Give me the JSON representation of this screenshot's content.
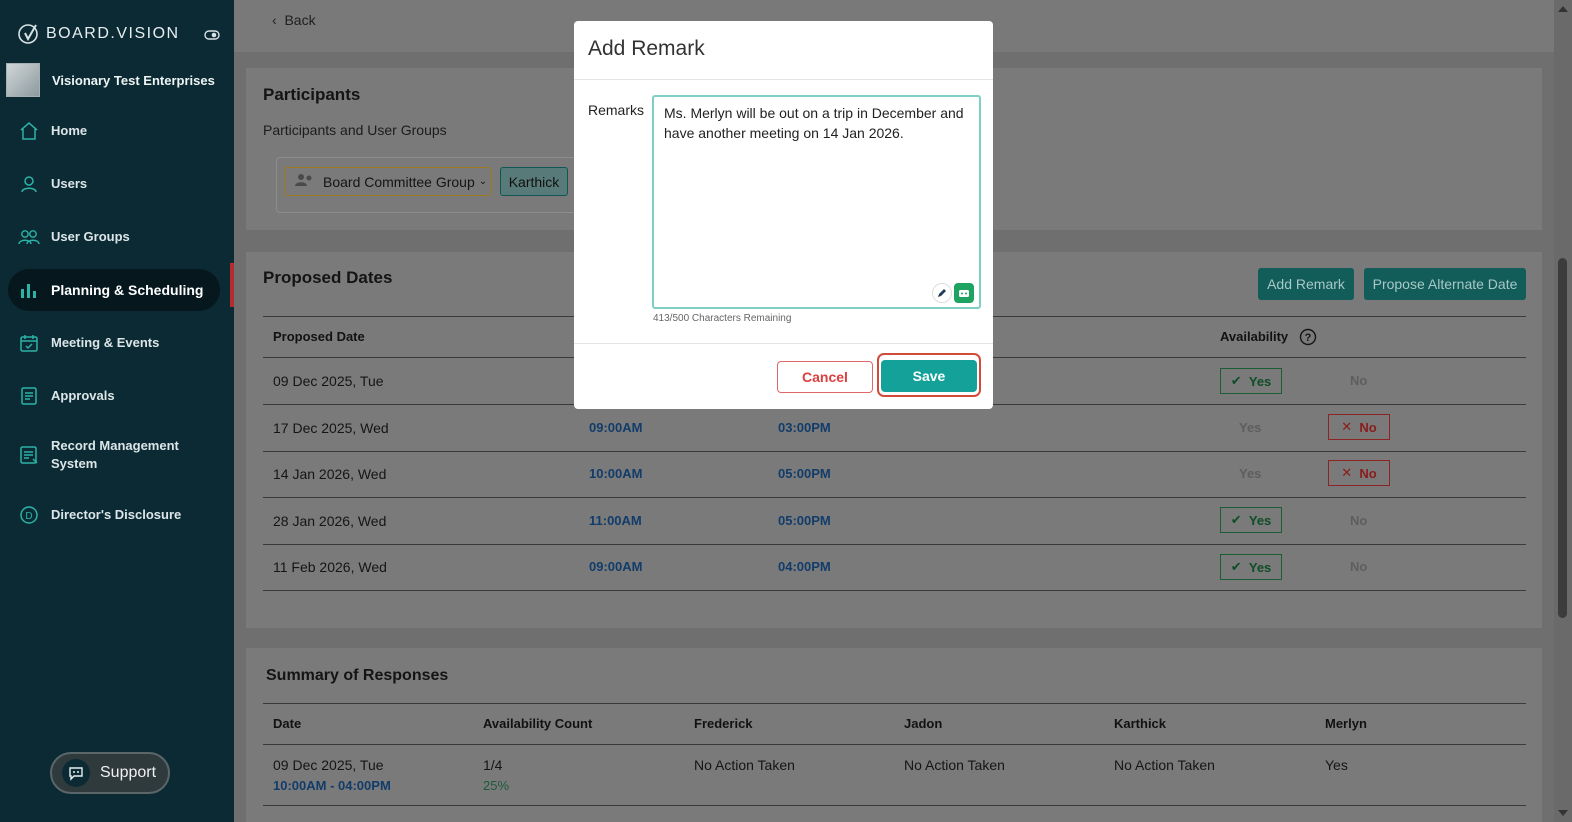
{
  "sidebar": {
    "logo": "BOARD.VISION",
    "org_name": "Visionary Test Enterprises",
    "items": [
      {
        "label": "Home",
        "icon": "home-icon"
      },
      {
        "label": "Users",
        "icon": "user-icon"
      },
      {
        "label": "User Groups",
        "icon": "users-icon"
      },
      {
        "label": "Planning & Scheduling",
        "icon": "bar-chart-icon",
        "active": true
      },
      {
        "label": "Meeting & Events",
        "icon": "calendar-icon"
      },
      {
        "label": "Approvals",
        "icon": "document-icon"
      },
      {
        "label": "Record Management System",
        "label_line1": "Record Management",
        "label_line2": "System",
        "icon": "records-icon"
      },
      {
        "label": "Director's Disclosure",
        "icon": "disclosure-icon"
      }
    ],
    "support_label": "Support"
  },
  "header": {
    "back_label": "Back"
  },
  "participants": {
    "title": "Participants",
    "subtitle": "Participants and User Groups",
    "group_chip": "Board Committee Group",
    "person_chip": "Karthick"
  },
  "proposed_dates": {
    "title": "Proposed Dates",
    "add_remark_label": "Add Remark",
    "propose_alternate_label": "Propose Alternate Date",
    "columns": {
      "date": "Proposed Date",
      "availability": "Availability"
    },
    "rows": [
      {
        "date": "09 Dec 2025, Tue",
        "start": "",
        "end": "",
        "selected": "Yes"
      },
      {
        "date": "17 Dec 2025, Wed",
        "start": "09:00AM",
        "end": "03:00PM",
        "selected": "No"
      },
      {
        "date": "14 Jan 2026, Wed",
        "start": "10:00AM",
        "end": "05:00PM",
        "selected": "No"
      },
      {
        "date": "28 Jan 2026, Wed",
        "start": "11:00AM",
        "end": "05:00PM",
        "selected": "Yes"
      },
      {
        "date": "11 Feb 2026, Wed",
        "start": "09:00AM",
        "end": "04:00PM",
        "selected": "Yes"
      }
    ],
    "yes_label": "Yes",
    "no_label": "No"
  },
  "summary": {
    "title": "Summary of Responses",
    "columns": [
      "Date",
      "Availability Count",
      "Frederick",
      "Jadon",
      "Karthick",
      "Merlyn"
    ],
    "row": {
      "date": "09 Dec 2025, Tue",
      "time": "10:00AM - 04:00PM",
      "count": "1/4",
      "percent": "25%",
      "frederick": "No Action Taken",
      "jadon": "No Action Taken",
      "karthick": "No Action Taken",
      "merlyn": "Yes"
    }
  },
  "modal": {
    "title": "Add Remark",
    "remarks_label": "Remarks",
    "remarks_value": "Ms. Merlyn will be out on a trip in December and have another meeting on 14 Jan 2026.",
    "chars_remaining": "413/500 Characters Remaining",
    "cancel_label": "Cancel",
    "save_label": "Save"
  },
  "colors": {
    "sidebar_bg": "#0c2a33",
    "accent_teal": "#13a199",
    "highlight_ring": "#d24a3a",
    "cancel_red": "#d9403f"
  }
}
